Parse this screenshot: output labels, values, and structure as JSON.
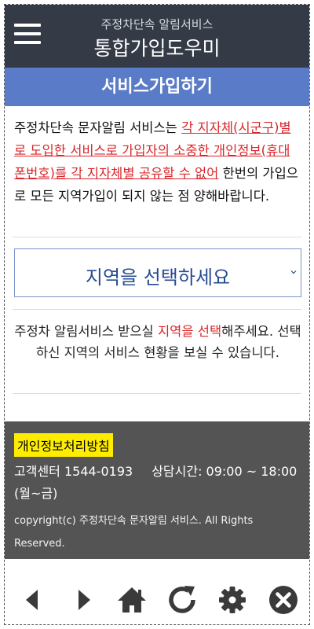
{
  "header": {
    "subtitle": "주정차단속 알림서비스",
    "title": "통합가입도우미"
  },
  "banner": {
    "title": "서비스가입하기"
  },
  "notice": {
    "part1": "주정차단속 문자알림 서비스는 ",
    "highlight": "각 지자체(시군구)별로 도입한 서비스로 가입자의 소중한 개인정보(휴대폰번호)를 각 지자체별 공유할 수 없어",
    "part2": " 한번의 가입으로 모든 지역가입이 되지 않는 점 양해바랍니다."
  },
  "region_select": {
    "selected": "지역을 선택하세요",
    "icon": "chevron-down-icon"
  },
  "guide": {
    "part1": "주정차 알림서비스 받으실 ",
    "highlight": "지역을 선택",
    "part2": "해주세요. 선택하신 지역의 서비스 현황을 보실 수 있습니다."
  },
  "footer": {
    "privacy_label": "개인정보처리방침",
    "customer_center": "고객센터 1544-0193",
    "hours": "상담시간: 09:00 ~ 18:00 (월~금)",
    "copyright": "copyright(c) 주정차단속 문자알림 서비스. All Rights Reserved."
  },
  "toolbar": {
    "icons": [
      "back-icon",
      "forward-icon",
      "home-icon",
      "refresh-icon",
      "gear-icon",
      "close-icon"
    ],
    "color": "#3a3a3a"
  },
  "colors": {
    "header_bg": "#343b46",
    "banner_bg": "#5a7bc8",
    "highlight_red": "#d9262b",
    "select_text": "#274a92",
    "footer_bg": "#545454",
    "privacy_bg": "#ffed00"
  }
}
